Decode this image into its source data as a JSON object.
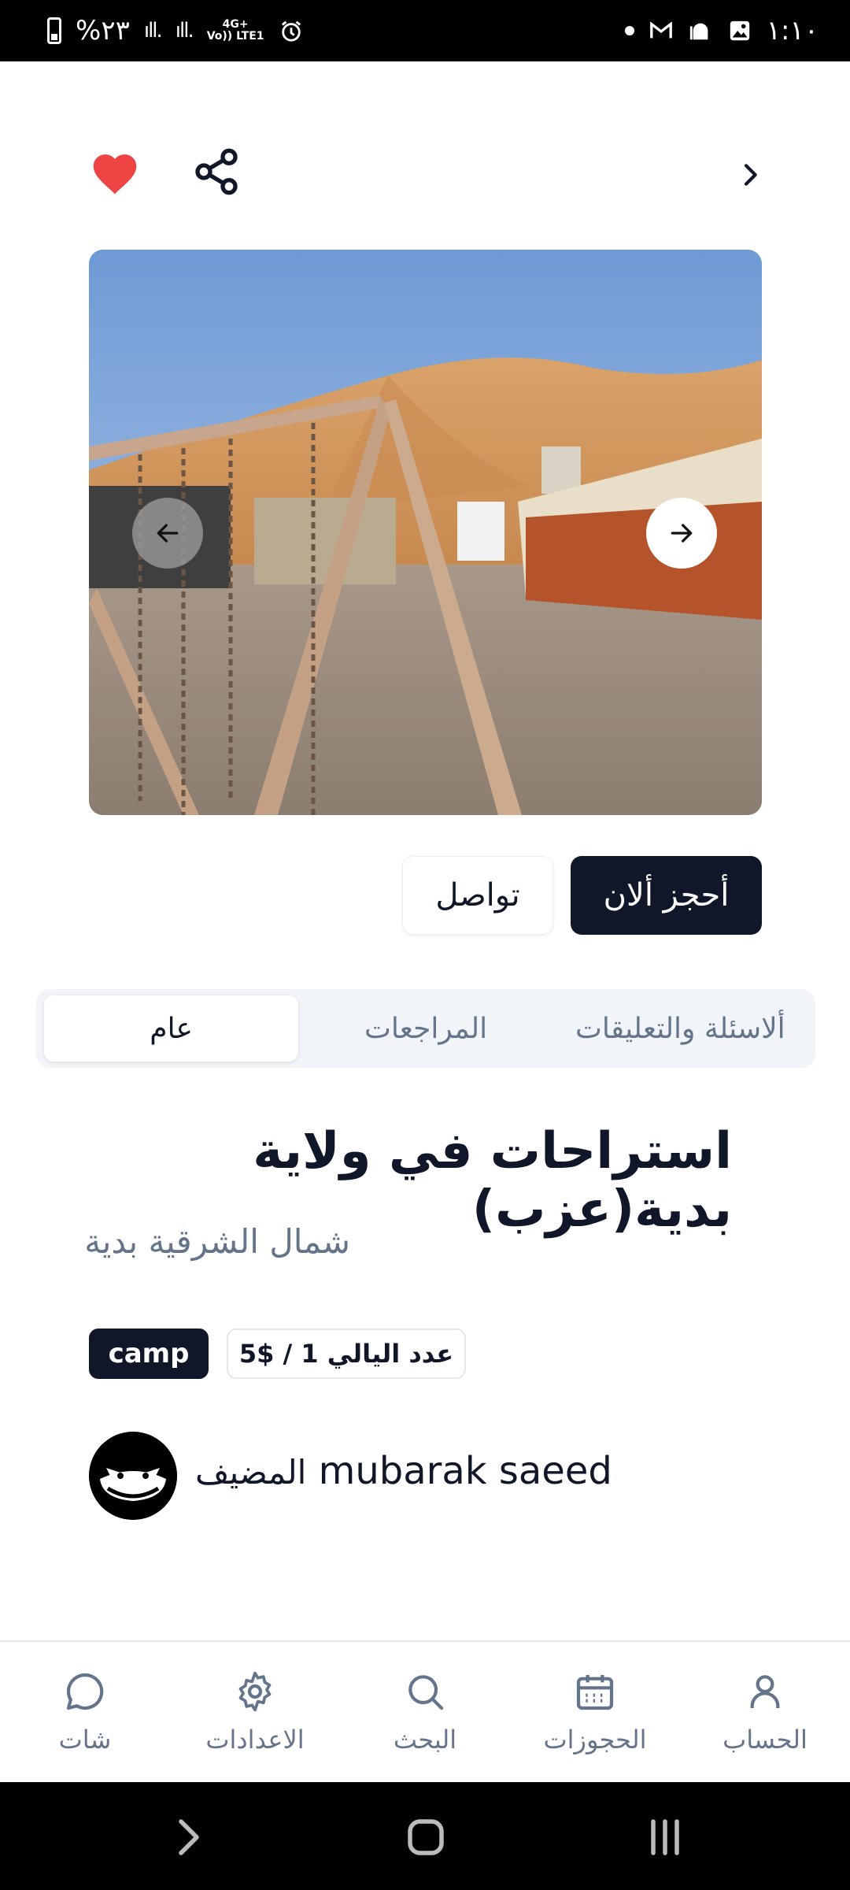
{
  "status_bar": {
    "battery_text": "%٢٣",
    "signal1": "ıll.",
    "signal2": "ıll.",
    "net_top": "4G+",
    "net_bottom": "Vo)) LTE1",
    "time": "١:١٠"
  },
  "listing": {
    "title": "استراحات في ولاية بدية(عزب)",
    "location": "شمال الشرقية بدية",
    "price_badge": "عدد اليالي 1 / $5",
    "type_badge": "camp",
    "host_name": "mubarak saeed",
    "host_label": "المضيف"
  },
  "actions": {
    "book_label": "أحجز ألان",
    "contact_label": "تواصل"
  },
  "tabs": [
    {
      "label": "عام",
      "active": true
    },
    {
      "label": "المراجعات",
      "active": false
    },
    {
      "label": "ألاسئلة والتعليقات",
      "active": false
    }
  ],
  "bottom_nav": {
    "account": "الحساب",
    "bookings": "الحجوزات",
    "search": "البحث",
    "settings": "الاعدادات",
    "chat": "شات"
  },
  "colors": {
    "primary": "#0f1728",
    "heart": "#ef4444",
    "muted": "#64748b"
  }
}
